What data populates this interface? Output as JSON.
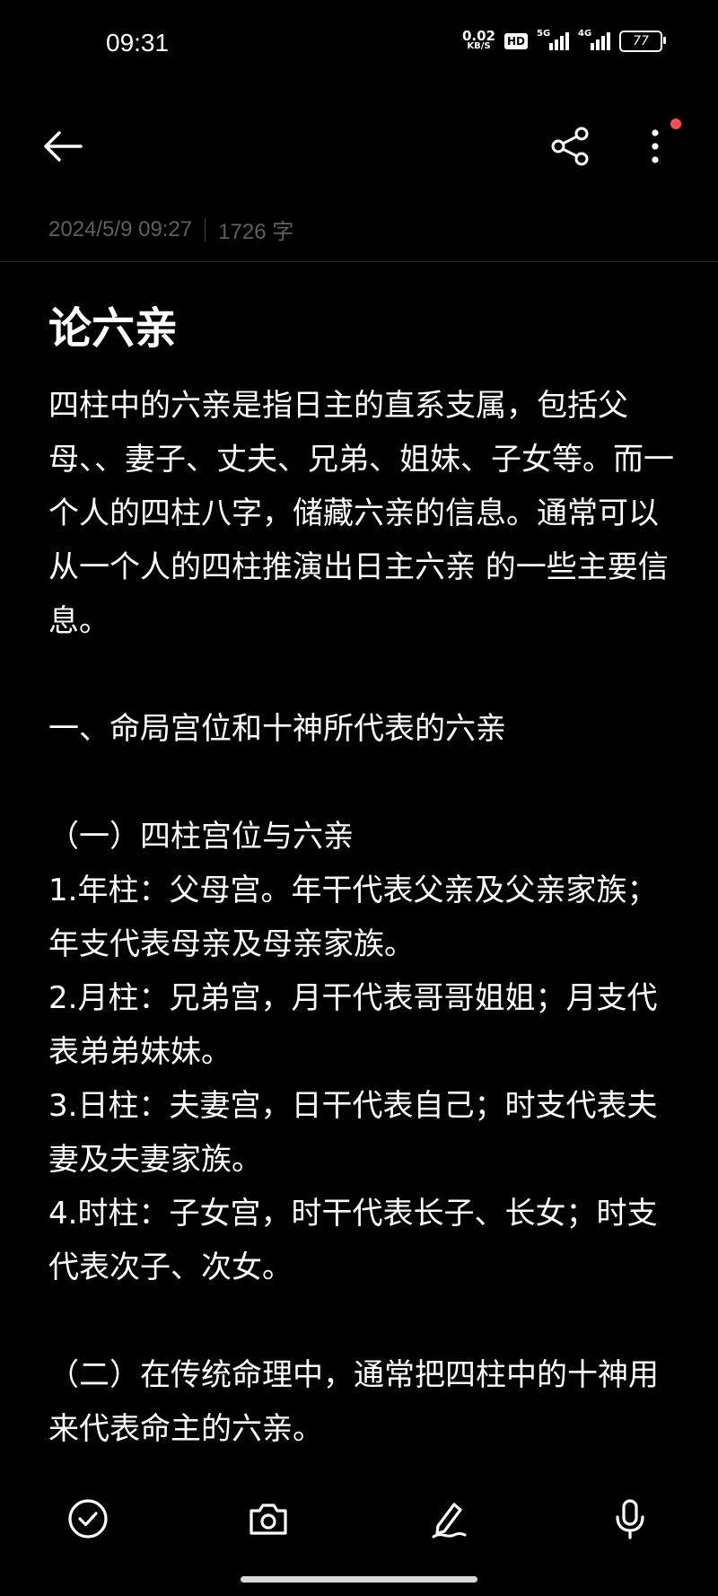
{
  "status_bar": {
    "time": "09:31",
    "net_speed_value": "0.02",
    "net_speed_unit": "KB/S",
    "hd_badge": "HD",
    "signal1_label": "5G",
    "signal2_label": "4G",
    "battery": "77"
  },
  "toolbar": {
    "back_icon": "arrow-left-icon",
    "share_icon": "share-icon",
    "more_icon": "more-vertical-icon",
    "notification_dot_color": "#ff4d4f"
  },
  "note": {
    "date": "2024/5/9 09:27",
    "word_count": "1726 字",
    "title": "论六亲",
    "paragraphs": [
      "四柱中的六亲是指日主的直系支属，包括父母、、妻子、丈夫、兄弟、姐妹、子女等。而一个人的四柱八字，储藏六亲的信息。通常可以从一个人的四柱推演出日主六亲 的一些主要信息。",
      "",
      "一、命局宫位和十神所代表的六亲",
      "",
      "（一）四柱宫位与六亲",
      "1.年柱：父母宫。年干代表父亲及父亲家族；年支代表母亲及母亲家族。",
      "2.月柱：兄弟宫，月干代表哥哥姐姐；月支代表弟弟妹妹。",
      "3.日柱：夫妻宫，日干代表自己；时支代表夫妻及夫妻家族。",
      "4.时柱：子女宫，时干代表长子、长女；时支 代表次子、次女。",
      "",
      "（二）在传统命理中，通常把四柱中的十神用来代表命主的六亲。"
    ]
  },
  "bottom_bar": {
    "checklist_icon": "checkmark-circle-icon",
    "camera_icon": "camera-icon",
    "handwriting_icon": "pen-icon",
    "voice_icon": "microphone-icon"
  }
}
